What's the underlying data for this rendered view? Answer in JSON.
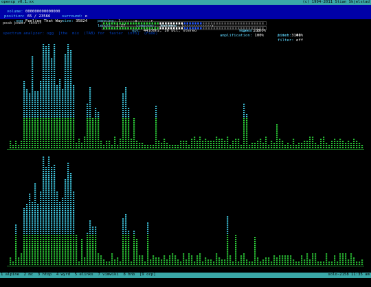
{
  "title_bar": {
    "left": "opencp v0.1.xx",
    "right": "(c) 1994-2011 Stian Skjelstad"
  },
  "info": {
    "row1": [
      {
        "label": "volume:",
        "value": "000000000000000"
      },
      {
        "label": "surround:",
        "value": "o"
      },
      {
        "label": "panning:",
        "value": "l------a------r"
      },
      {
        "label": "balance:",
        "value": "l------------r"
      },
      {
        "label": "speed:",
        "value": "100%"
      },
      {
        "label": "pitch:",
        "value": "100%"
      }
    ],
    "row2": [
      {
        "label": "position:",
        "value": "65 / 23566"
      },
      {
        "label": "size:",
        "value": "35824"
      },
      {
        "label": "length:",
        "value": "3:27"
      },
      {
        "label": "opt:",
        "value": "44100Hz, 16 bit, stereo"
      },
      {
        "label": "amplification:",
        "value": "100%"
      },
      {
        "label": "filter:",
        "value": "off"
      }
    ],
    "row3": [
      {
        "label": ".ogg",
        "value": "Feeling That Way"
      },
      {
        "label": "composer:",
        "value": "Journey"
      },
      {
        "label": "kbps:",
        "value": "180"
      },
      {
        "label": "time:",
        "value": "3:41"
      }
    ],
    "file": "Feeling .ogg"
  },
  "peak": {
    "label": "peak power level:",
    "left_level": 0.62,
    "right_level": 0.62
  },
  "scopes_caption": "spectrum analyzer: ogg  [the  mix  (TAB) for  faster  info]  (Fade)",
  "colors": {
    "cyan": "#40c8e0",
    "green": "#2ed23a",
    "status_bar": "#3aa8a8",
    "info_bg": "#0000a8"
  },
  "bottom_bar": {
    "left": "1 alpine  2 mc  3 htop  4 wyrd  5 elinks  7 vimwiki  8 hnb  [9 ocp]",
    "right": "solo-2158 11:35 am"
  }
}
